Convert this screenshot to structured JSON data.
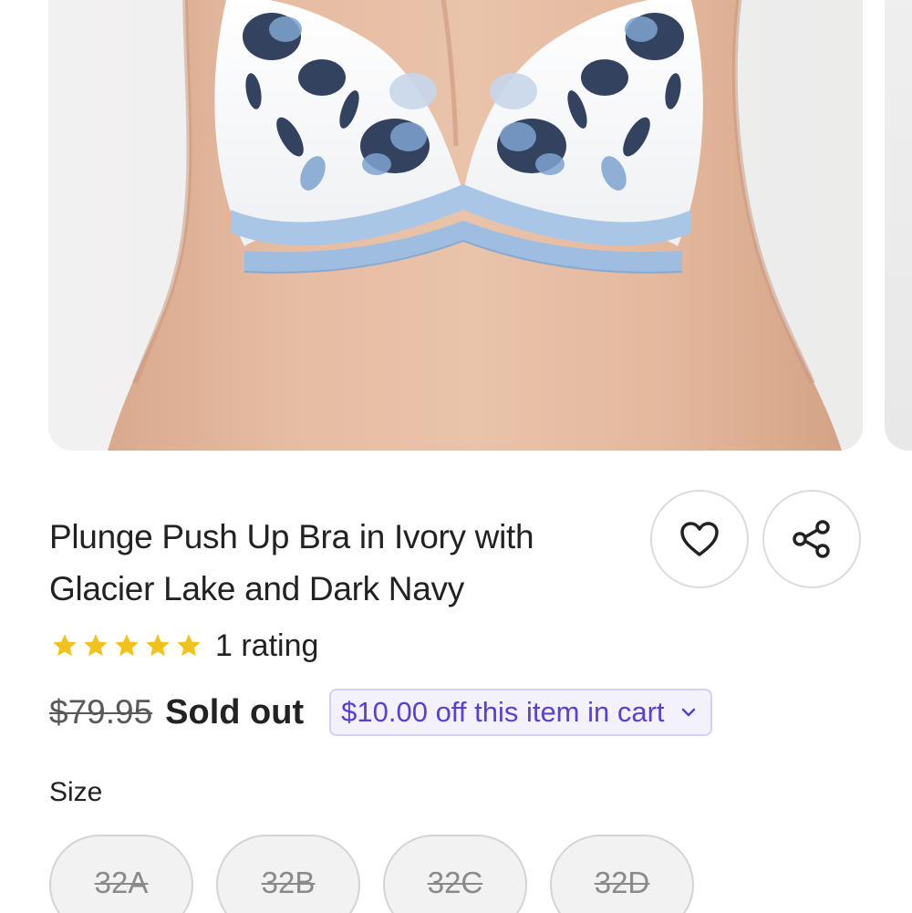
{
  "carousel": {
    "image_alt": "Model wearing ivory plunge push up bra with blue floral embroidery"
  },
  "product": {
    "title": "Plunge Push Up Bra in Ivory with Glacier Lake and Dark Navy",
    "rating": {
      "stars": 5,
      "max_stars": 5,
      "text": "1 rating"
    },
    "price": {
      "original": "$79.95",
      "status": "Sold out"
    },
    "promo": {
      "label": "$10.00 off this item in cart"
    }
  },
  "actions": {
    "favorite_icon": "heart-icon",
    "share_icon": "share-icon"
  },
  "size": {
    "label": "Size",
    "options": [
      "32A",
      "32B",
      "32C",
      "32D"
    ]
  },
  "colors": {
    "star": "#f1c21b",
    "promo_text": "#5a3fd6",
    "promo_bg": "#f4f1ff",
    "promo_border": "#d7cef8",
    "skin": "#e2b89e",
    "bra_band": "#a9c6e6",
    "embroidery_navy": "#1e2f4f"
  }
}
